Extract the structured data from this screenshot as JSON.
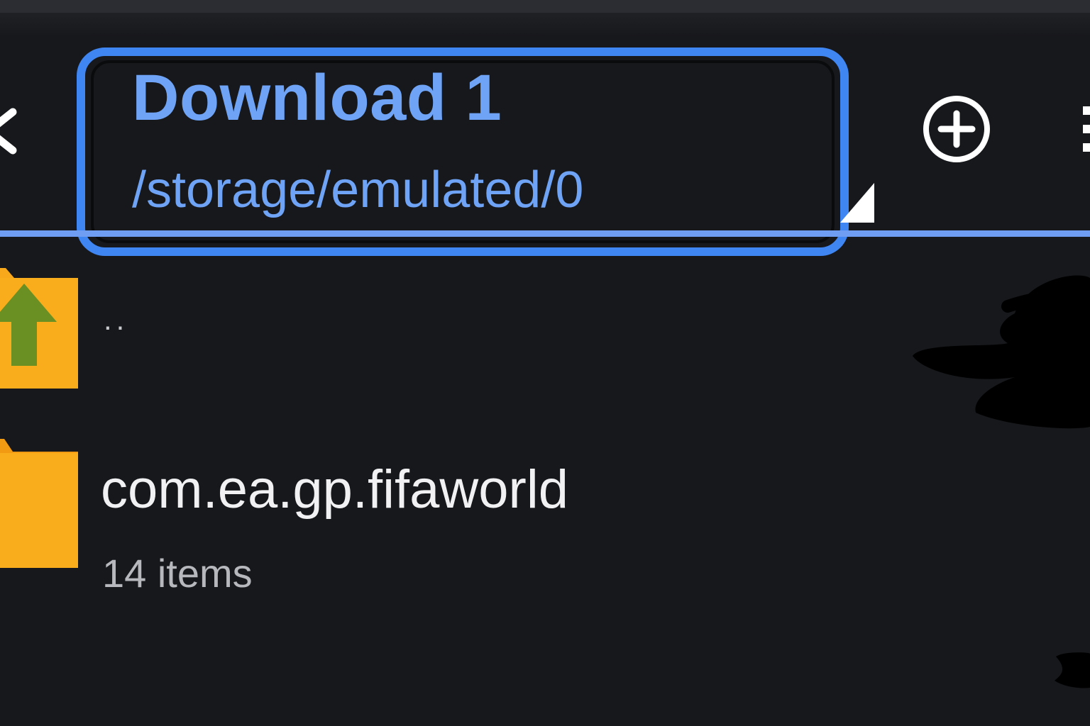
{
  "toolbar": {
    "title": "Download 1",
    "path": "/storage/emulated/0",
    "back_icon": "chevron-left-icon",
    "add_icon": "add-circle-icon",
    "menu_icon": "more-vert-icon"
  },
  "files": {
    "parent": {
      "label": "..",
      "icon": "folder-up-icon"
    },
    "folder": {
      "name": "com.ea.gp.fifaworld",
      "meta": "14 items",
      "icon": "folder-icon"
    }
  },
  "colors": {
    "background": "#17181b",
    "accent": "#6ea3f5",
    "highlight_border": "#3f86f2",
    "folder": "#f7a81b",
    "arrow": "#6a8f22"
  }
}
